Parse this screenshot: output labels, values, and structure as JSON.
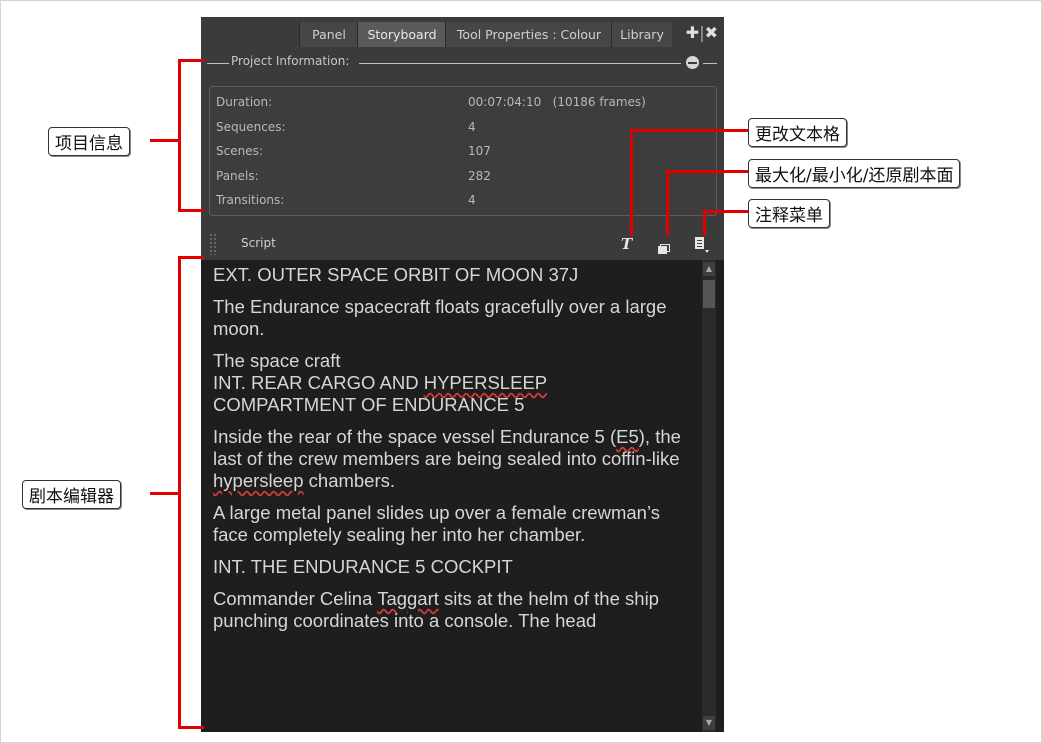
{
  "tabs": [
    {
      "label": "Panel",
      "active": false
    },
    {
      "label": "Storyboard",
      "active": true
    },
    {
      "label": "Tool Properties : Colour",
      "active": false
    },
    {
      "label": "Library",
      "active": false
    }
  ],
  "project_info": {
    "header": "Project Information:",
    "rows": [
      {
        "label": "Duration:",
        "value": "00:07:04:10   (10186 frames)"
      },
      {
        "label": "Sequences:",
        "value": "4"
      },
      {
        "label": "Scenes:",
        "value": "107"
      },
      {
        "label": "Panels:",
        "value": "282"
      },
      {
        "label": "Transitions:",
        "value": "4"
      }
    ]
  },
  "script": {
    "label": "Script",
    "icons": [
      "text-format-icon",
      "maximize-restore-icon",
      "notes-menu-icon"
    ]
  },
  "editor": {
    "p1": "EXT. OUTER SPACE ORBIT OF MOON 37J",
    "p2": "The Endurance spacecraft floats gracefully over a large moon.",
    "p3a": "The space craft",
    "p3b_pre": "INT. REAR CARGO AND ",
    "p3b_err": "HYPERSLEEP",
    "p3c": "COMPARTMENT OF ENDURANCE 5",
    "p4_pre": "Inside the rear of the space vessel Endurance 5 (",
    "p4_err1": "E5",
    "p4_mid": "), the last of the crew members are being sealed into coffin-like ",
    "p4_err2": "hypersleep",
    "p4_post": " chambers.",
    "p5": "A large metal panel slides up over a female crewman’s face completely sealing her into her chamber.",
    "p6": "INT. THE ENDURANCE 5 COCKPIT",
    "p7_pre": "Commander Celina ",
    "p7_err": "Taggart",
    "p7_post": " sits at the helm of the ship punching coordinates into a console. The head"
  },
  "callouts": {
    "project_info": "项目信息",
    "text_format": "更改文本格",
    "maximize": "最大化/最小化/还原剧本面",
    "notes_menu": "注释菜单",
    "script_editor": "剧本编辑器"
  },
  "colors": {
    "annotation": "#e00000",
    "panel_bg": "#3b3b3b",
    "editor_bg": "#1e1e1e"
  }
}
